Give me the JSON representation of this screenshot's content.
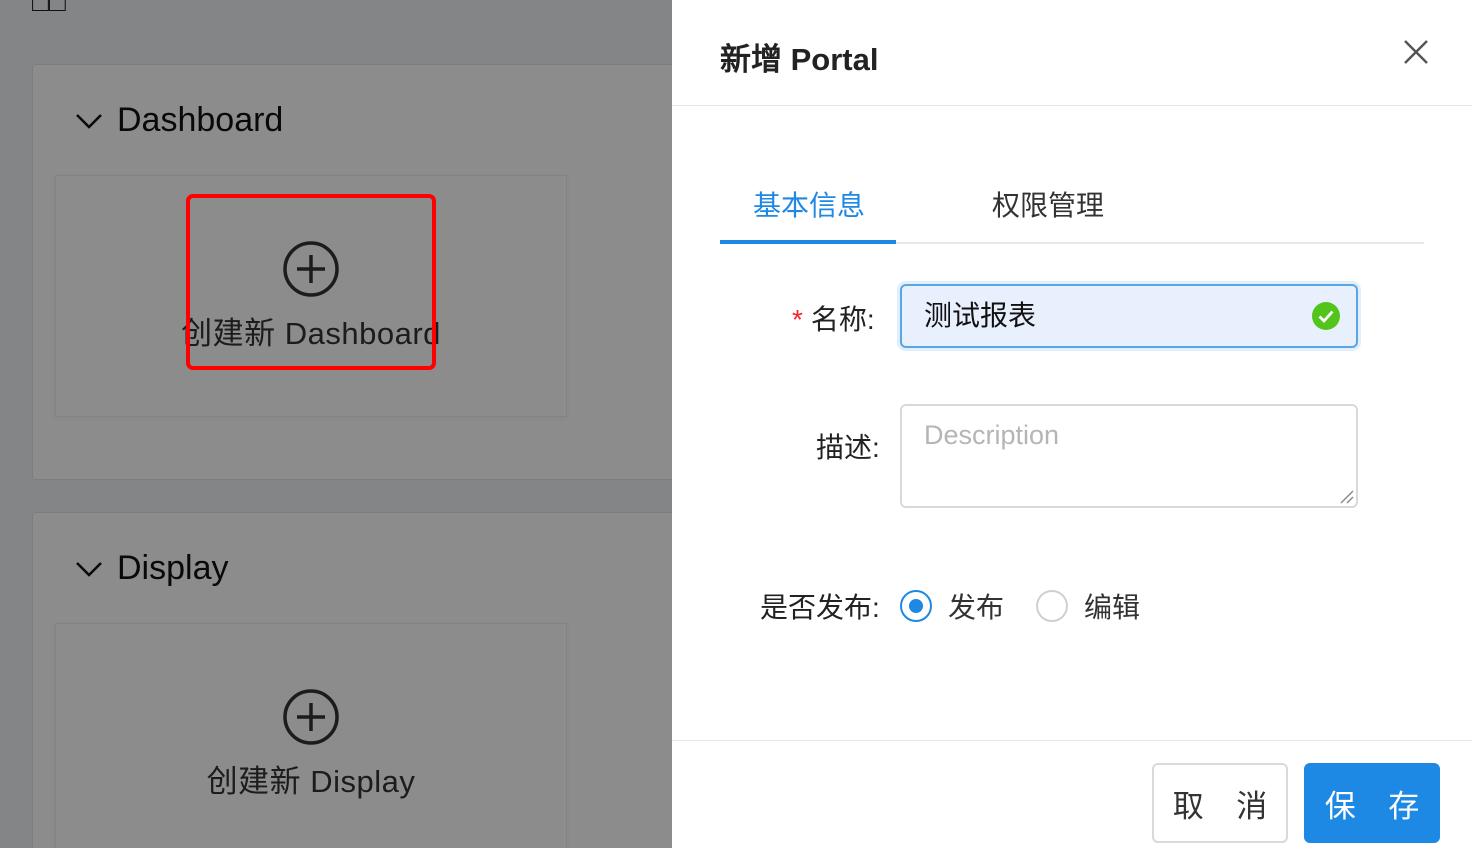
{
  "background": {
    "sections": [
      {
        "title": "Dashboard",
        "create_label": "创建新 Dashboard"
      },
      {
        "title": "Display",
        "create_label": "创建新 Display"
      }
    ]
  },
  "drawer": {
    "title": "新增 Portal",
    "tabs": [
      {
        "label": "基本信息",
        "active": true
      },
      {
        "label": "权限管理",
        "active": false
      }
    ],
    "form": {
      "name_label": "名称:",
      "name_required_mark": "*",
      "name_value": "测试报表",
      "description_label": "描述:",
      "description_placeholder": "Description",
      "publish_label": "是否发布:",
      "publish_options": [
        "发布",
        "编辑"
      ],
      "publish_selected": "发布"
    },
    "footer": {
      "cancel_label": "取 消",
      "save_label": "保 存"
    }
  },
  "colors": {
    "primary": "#1e88e5",
    "highlight_box": "#ff0000",
    "success_check": "#52c41a",
    "required": "#f5222d"
  }
}
